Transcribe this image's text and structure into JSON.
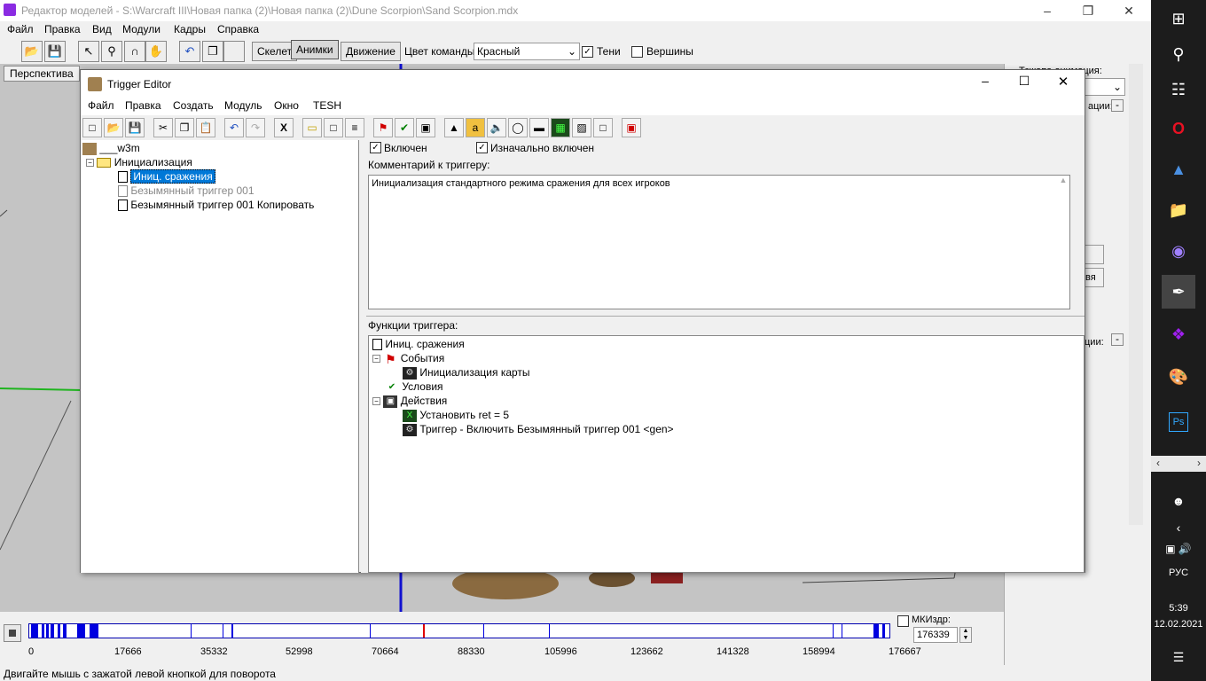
{
  "window": {
    "title": "Редактор моделей - S:\\Warcraft III\\Новая папка (2)\\Новая папка (2)\\Dune Scorpion\\Sand Scorpion.mdx"
  },
  "menu": [
    "Файл",
    "Правка",
    "Вид",
    "Модули",
    "Кадры",
    "Справка"
  ],
  "toolbar": {
    "tabs": [
      "Скелет",
      "Анимки",
      "Движение"
    ],
    "team_color_label": "Цвет команды:",
    "team_color_value": "Красный",
    "shadows_label": "Тени",
    "vertices_label": "Вершины"
  },
  "viewport": {
    "perspective_button": "Перспектива"
  },
  "timeline": {
    "ticks": [
      "0",
      "17666",
      "35332",
      "52998",
      "70664",
      "88330",
      "105996",
      "123662",
      "141328",
      "158994",
      "176667"
    ],
    "mk_label": "МКИздр:",
    "mk_value": "176339"
  },
  "status": "Двигайте мышь с зажатой левой кнопкой для поворота",
  "right_panel": {
    "label1": "Тсжапа онимация:",
    "label2": "ации:",
    "label3": "ции:",
    "label4": "вя"
  },
  "trigger_editor": {
    "title": "Trigger Editor",
    "menu": [
      "Файл",
      "Правка",
      "Создать",
      "Модуль",
      "Окно",
      "TESH"
    ],
    "tree": {
      "root": "___w3m",
      "folder": "Инициализация",
      "items": [
        "Иниц. сражения",
        "Безымянный триггер 001",
        "Безымянный триггер 001 Копировать"
      ]
    },
    "enabled_label": "Включен",
    "initially_enabled_label": "Изначально включен",
    "comment_label": "Комментарий к триггеру:",
    "comment_text": "Инициализация стандартного режима сражения для всех игроков",
    "functions_label": "Функции триггера:",
    "functions": {
      "trigger": "Иниц. сражения",
      "events": "События",
      "event_1": "Инициализация карты",
      "conditions": "Условия",
      "actions": "Действия",
      "action_1": "Установить ret = 5",
      "action_2": "Триггер - Включить Безымянный триггер 001 <gen>"
    }
  },
  "taskbar": {
    "lang": "РУС",
    "time": "5:39",
    "date": "12.02.2021"
  }
}
